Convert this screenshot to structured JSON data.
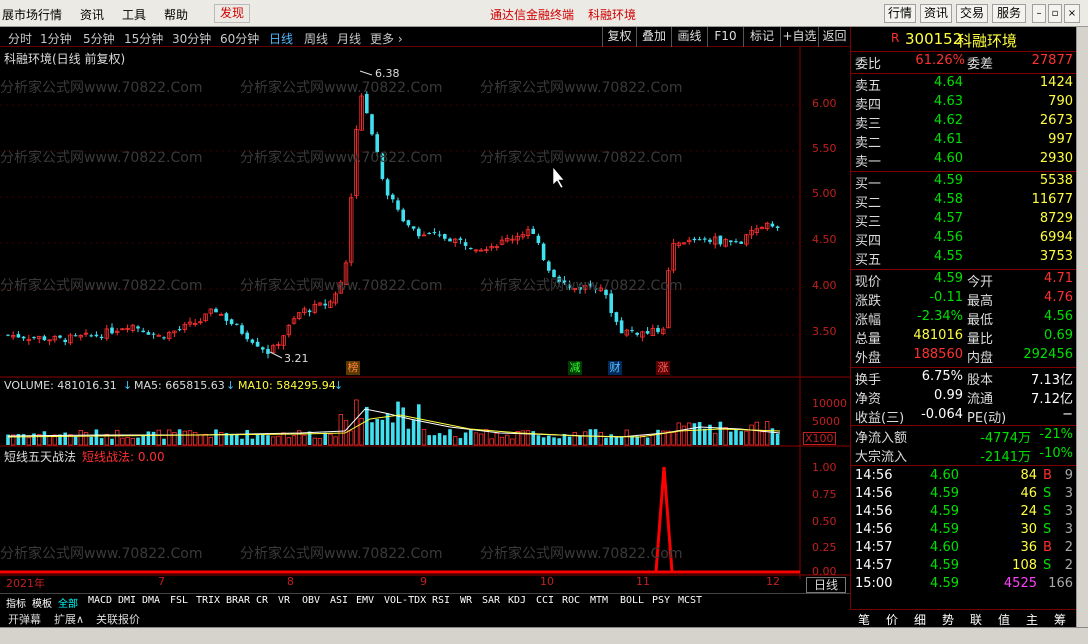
{
  "menu": {
    "items": [
      "展市场行情",
      "资讯",
      "工具",
      "帮助",
      "发现"
    ],
    "center_links": [
      "通达信金融终端",
      "科融环境"
    ],
    "right_buttons": [
      "行情",
      "资讯",
      "交易",
      "服务"
    ]
  },
  "toolbar": {
    "periods": [
      "分时",
      "1分钟",
      "5分钟",
      "15分钟",
      "30分钟",
      "60分钟",
      "日线",
      "周线",
      "月线",
      "更多 ›"
    ],
    "selected_period": "日线",
    "actions": [
      "复权",
      "叠加",
      "画线",
      "F10",
      "标记",
      "+自选",
      "返回"
    ]
  },
  "chart": {
    "title": "科融环境(日线 前复权)",
    "high_label": "6.38",
    "low_label": "3.21",
    "price_axis": [
      "6.00",
      "5.50",
      "5.00",
      "4.50",
      "4.00",
      "3.50"
    ],
    "badges": [
      "榜",
      "减",
      "财",
      "涨"
    ],
    "volume_header": {
      "vol": "VOLUME: 481016.31",
      "ma5": "MA5: 665815.63",
      "ma10": "MA10: 584295.94"
    },
    "volume_axis": [
      "10000",
      "5000",
      "X100"
    ],
    "indicator_header": {
      "name": "短线五天战法",
      "line": "短线战法: 0.00"
    },
    "indicator_axis": [
      "1.00",
      "0.75",
      "0.50",
      "0.25",
      "0.00"
    ],
    "date_axis": [
      "2021年",
      "7",
      "8",
      "9",
      "10",
      "11",
      "12"
    ],
    "period_label": "日线",
    "zoom_controls": [
      "+",
      "−",
      "0"
    ],
    "watermark": "分析家公式网www.70822.Com"
  },
  "indicator_tabs": [
    "指标",
    "模板",
    "全部",
    "MACD",
    "DMI",
    "DMA",
    "FSL",
    "TRIX",
    "BRAR",
    "CR",
    "VR",
    "OBV",
    "ASI",
    "EMV",
    "VOL-TDX",
    "RSI",
    "WR",
    "SAR",
    "KDJ",
    "CCI",
    "ROC",
    "MTM",
    "BOLL",
    "PSY",
    "MCST"
  ],
  "indicator_tabs2": [
    "开弹幕",
    "扩展∧",
    "关联报价"
  ],
  "quote": {
    "code": "300152",
    "name": "科融环境",
    "weibi": {
      "label": "委比",
      "value": "61.26%",
      "label2": "委差",
      "value2": "27877"
    },
    "asks": [
      {
        "label": "卖五",
        "price": "4.64",
        "vol": "1424"
      },
      {
        "label": "卖四",
        "price": "4.63",
        "vol": "790"
      },
      {
        "label": "卖三",
        "price": "4.62",
        "vol": "2673"
      },
      {
        "label": "卖二",
        "price": "4.61",
        "vol": "997"
      },
      {
        "label": "卖一",
        "price": "4.60",
        "vol": "2930"
      }
    ],
    "bids": [
      {
        "label": "买一",
        "price": "4.59",
        "vol": "5538"
      },
      {
        "label": "买二",
        "price": "4.58",
        "vol": "11677"
      },
      {
        "label": "买三",
        "price": "4.57",
        "vol": "8729"
      },
      {
        "label": "买四",
        "price": "4.56",
        "vol": "6994"
      },
      {
        "label": "买五",
        "price": "4.55",
        "vol": "3753"
      }
    ],
    "stats": [
      {
        "l1": "现价",
        "v1": "4.59",
        "c1": "green",
        "l2": "今开",
        "v2": "4.71",
        "c2": "red"
      },
      {
        "l1": "涨跌",
        "v1": "-0.11",
        "c1": "green",
        "l2": "最高",
        "v2": "4.76",
        "c2": "red"
      },
      {
        "l1": "涨幅",
        "v1": "-2.34%",
        "c1": "green",
        "l2": "最低",
        "v2": "4.56",
        "c2": "green"
      },
      {
        "l1": "总量",
        "v1": "481016",
        "c1": "yel",
        "l2": "量比",
        "v2": "0.69",
        "c2": "green"
      },
      {
        "l1": "外盘",
        "v1": "188560",
        "c1": "red",
        "l2": "内盘",
        "v2": "292456",
        "c2": "green"
      }
    ],
    "stats2": [
      {
        "l1": "换手",
        "v1": "6.75%",
        "l2": "股本",
        "v2": "7.13亿"
      },
      {
        "l1": "净资",
        "v1": "0.99",
        "l2": "流通",
        "v2": "7.12亿"
      },
      {
        "l1": "收益(三)",
        "v1": "-0.064",
        "l2": "PE(动)",
        "v2": "−"
      }
    ],
    "flows": [
      {
        "label": "净流入额",
        "value": "-4774万",
        "pct": "-21%"
      },
      {
        "label": "大宗流入",
        "value": "-2141万",
        "pct": "-10%"
      }
    ],
    "ticks": [
      {
        "time": "14:56",
        "price": "4.60",
        "vol": "84",
        "side": "B",
        "n": "9"
      },
      {
        "time": "14:56",
        "price": "4.59",
        "vol": "46",
        "side": "S",
        "n": "3"
      },
      {
        "time": "14:56",
        "price": "4.59",
        "vol": "24",
        "side": "S",
        "n": "3"
      },
      {
        "time": "14:56",
        "price": "4.59",
        "vol": "30",
        "side": "S",
        "n": "3"
      },
      {
        "time": "14:57",
        "price": "4.60",
        "vol": "36",
        "side": "B",
        "n": "2"
      },
      {
        "time": "14:57",
        "price": "4.59",
        "vol": "108",
        "side": "S",
        "n": "2"
      },
      {
        "time": "15:00",
        "price": "4.59",
        "vol": "4525",
        "side": "",
        "n": "166"
      }
    ],
    "tabs": [
      "笔",
      "价",
      "细",
      "势",
      "联",
      "值",
      "主",
      "筹"
    ]
  }
}
